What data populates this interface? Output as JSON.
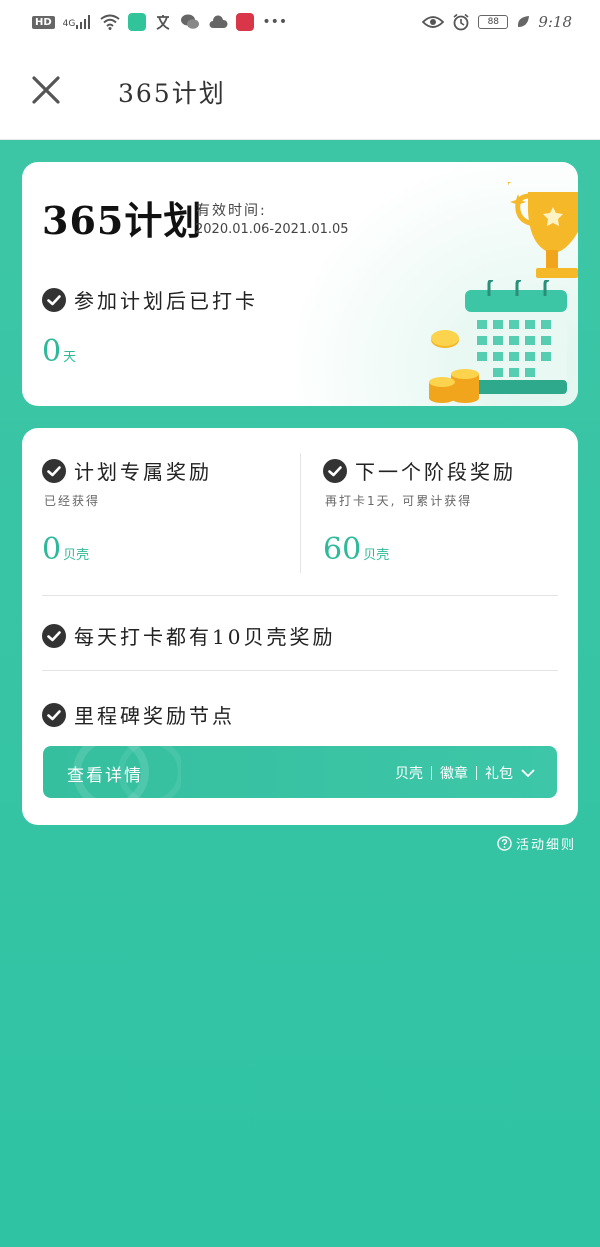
{
  "status_bar": {
    "hd": "HD",
    "network": "4G",
    "time": "9:18",
    "battery": "88"
  },
  "header": {
    "title": "365计划"
  },
  "plan_card": {
    "title": "365计划",
    "valid_label": "有效时间:",
    "valid_range": "2020.01.06-2021.01.05",
    "checkin_label": "参加计划后已打卡",
    "days_value": "0",
    "days_unit": "天"
  },
  "rewards_card": {
    "exclusive": {
      "label": "计划专属奖励",
      "sub": "已经获得",
      "value": "0",
      "unit": "贝壳"
    },
    "next_stage": {
      "label": "下一个阶段奖励",
      "sub": "再打卡1天, 可累计获得",
      "value": "60",
      "unit": "贝壳"
    },
    "daily": {
      "label": "每天打卡都有10贝壳奖励"
    },
    "milestone": {
      "label": "里程碑奖励节点"
    },
    "detail_bar": {
      "label": "查看详情",
      "tags": [
        "贝壳",
        "徽章",
        "礼包"
      ]
    }
  },
  "rules_link": "活动细则",
  "colors": {
    "accent": "#2fb99a",
    "background": "#33c3a3"
  },
  "icons": {
    "close": "close-icon",
    "check": "check-circle-icon",
    "trophy": "trophy-icon",
    "calendar": "calendar-icon",
    "coins": "coins-icon",
    "chevron": "chevron-down-icon",
    "help": "question-circle-icon"
  }
}
